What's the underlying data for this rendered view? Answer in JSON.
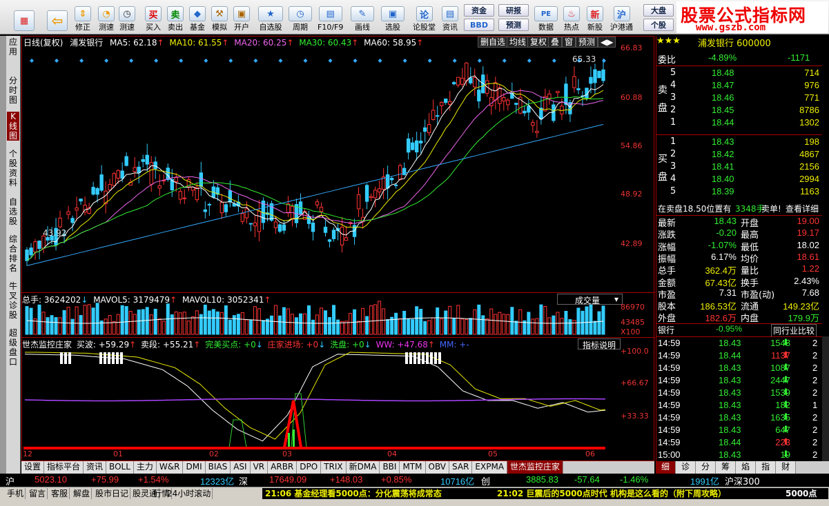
{
  "toolbar": [
    {
      "label": "修正",
      "icon": "↑"
    },
    {
      "label": "测速",
      "icon": "◔"
    },
    {
      "label": "买入",
      "icon": "买"
    },
    {
      "label": "卖出",
      "icon": "卖"
    },
    {
      "label": "基金",
      "icon": "◆"
    },
    {
      "label": "模拟",
      "icon": "⚒"
    },
    {
      "label": "开户",
      "icon": "🔒"
    },
    {
      "label": "自选股",
      "icon": "★"
    },
    {
      "label": "周期",
      "icon": "◷"
    },
    {
      "label": "F10/F9",
      "icon": "▤"
    },
    {
      "label": "画线",
      "icon": "✎"
    },
    {
      "label": "选股",
      "icon": "▣"
    },
    {
      "label": "论股堂",
      "icon": "论"
    },
    {
      "label": "资讯",
      "icon": "▤"
    },
    {
      "label": "数据",
      "icon": "PE"
    },
    {
      "label": "热点",
      "icon": "♨"
    },
    {
      "label": "新股",
      "icon": "新"
    },
    {
      "label": "沪港通",
      "icon": "沪"
    }
  ],
  "toolbar_small": {
    "zijin": "资金",
    "bbd": "BBD",
    "yanbao": "研报",
    "yuce": "预测",
    "dapan": "大盘",
    "gegu": "个股"
  },
  "brand": {
    "title": "股票公式指标网",
    "url": "www.gszb.com"
  },
  "left_tabs": [
    "应用",
    "分时图",
    "K线图",
    "个股资料",
    "自选股",
    "综合排名",
    "牛叉诊股",
    "超级盘口"
  ],
  "chart_header": {
    "period": "日线(复权)",
    "name": "浦发银行",
    "ma5": "MA5: 62.18",
    "ma10": "MA10: 61.55",
    "ma20": "MA20: 60.25",
    "ma30": "MA30: 60.43",
    "ma60": "MA60: 58.95"
  },
  "chart_ctrls": [
    "删自选",
    "均线",
    "复权",
    "叠",
    "窗",
    "预测",
    "◀▶"
  ],
  "price_labels": [
    "66.83",
    "60.88",
    "54.86",
    "48.92",
    "42.89"
  ],
  "high_label": "65.33",
  "low_label": "43.92",
  "vol_header": {
    "total": "总手: 3624202",
    "mavol5": "MAVOL5: 3179479",
    "mavol10": "MAVOL10: 3052341",
    "btn": "成交量"
  },
  "vol_labels": [
    "86970",
    "43485",
    "X100"
  ],
  "ind_header": {
    "name": "世杰监控庄家",
    "buy": "买波: +59.29",
    "sell": "卖段: +55.21",
    "perfect": "完美买点: +0",
    "dealer": "庄家进场: +0",
    "wash": "洗盘: +0",
    "ww": "WW: +47.68",
    "mm": "MM: +-",
    "btn": "指标说明"
  },
  "ind_labels": [
    "+100.0",
    "+66.67",
    "+33.33"
  ],
  "x_labels": [
    "12",
    "01",
    "02",
    "03",
    "04",
    "05",
    "06"
  ],
  "tabs": [
    "设置",
    "指标平台",
    "资讯",
    "BOLL",
    "主力",
    "W&R",
    "DMI",
    "BIAS",
    "ASI",
    "VR",
    "ARBR",
    "DPO",
    "TRIX",
    "新DMA",
    "BBI",
    "MTM",
    "OBV",
    "SAR",
    "EXPMA",
    "世杰监控庄家"
  ],
  "stock": {
    "title": "浦发银行 600000",
    "weibi_label": "委比",
    "weibi_pct": "-4.89%",
    "weibi_val": "-1171"
  },
  "sell_label": "卖盘",
  "buy_label": "买盘",
  "asks": [
    [
      "5",
      "18.48",
      "714"
    ],
    [
      "4",
      "18.47",
      "976"
    ],
    [
      "3",
      "18.46",
      "771"
    ],
    [
      "2",
      "18.45",
      "8786"
    ],
    [
      "1",
      "18.44",
      "1302"
    ]
  ],
  "bids": [
    [
      "1",
      "18.43",
      "198"
    ],
    [
      "2",
      "18.42",
      "4867"
    ],
    [
      "3",
      "18.41",
      "2156"
    ],
    [
      "4",
      "18.40",
      "2994"
    ],
    [
      "5",
      "18.39",
      "1163"
    ]
  ],
  "info_line": {
    "text": "在卖盘18.50位置有",
    "vol": "3348手",
    "link1": "卖单!",
    "link2": "查看详细"
  },
  "quote": [
    [
      "最新",
      "18.43",
      "开盘",
      "19.00"
    ],
    [
      "涨跌",
      "-0.20",
      "最高",
      "19.17"
    ],
    [
      "涨幅",
      "-1.07%",
      "最低",
      "18.02"
    ],
    [
      "振幅",
      "6.17%",
      "均价",
      "18.61"
    ],
    [
      "总手",
      "362.4万",
      "量比",
      "1.22"
    ],
    [
      "金额",
      "67.43亿",
      "换手",
      "2.43%"
    ],
    [
      "市盈",
      "7.31",
      "市盈(动)",
      "7.68"
    ],
    [
      "股本",
      "186.53亿",
      "流通",
      "149.23亿"
    ],
    [
      "外盘",
      "182.6万",
      "内盘",
      "179.9万"
    ]
  ],
  "sector": {
    "name": "银行",
    "pct": "-0.95%",
    "btn": "同行业比较"
  },
  "ticks": [
    [
      "14:59",
      "18.43",
      "1548",
      "2"
    ],
    [
      "14:59",
      "18.44",
      "1137",
      "2"
    ],
    [
      "14:59",
      "18.43",
      "1087",
      "2"
    ],
    [
      "14:59",
      "18.43",
      "2447",
      "2"
    ],
    [
      "14:59",
      "18.43",
      "1539",
      "2"
    ],
    [
      "14:59",
      "18.43",
      "182",
      "1"
    ],
    [
      "14:59",
      "18.43",
      "1635",
      "2"
    ],
    [
      "14:59",
      "18.43",
      "647",
      "2"
    ],
    [
      "14:59",
      "18.44",
      "223",
      "2"
    ],
    [
      "15:00",
      "18.43",
      "19",
      "2"
    ]
  ],
  "right_tabs": [
    "细",
    "诊",
    "分",
    "筹",
    "焰",
    "指",
    "财"
  ],
  "status": {
    "sh": "沪",
    "sh_idx": "5023.10",
    "sh_chg": "+75.99",
    "sh_pct": "+1.54%",
    "sh_amt": "12323亿",
    "sz": "深",
    "sz_idx": "17649.09",
    "sz_chg": "+148.03",
    "sz_pct": "+0.85%",
    "sz_amt": "10716亿",
    "cy": "创",
    "cy_idx": "3885.83",
    "cy_chg": "-57.64",
    "cy_pct": "-1.46%",
    "hs_amt": "1991亿",
    "hs": "沪深300"
  },
  "bottom": {
    "items": [
      "手机",
      "留言",
      "客服",
      "解盘",
      "股市日记",
      "股灵通",
      "行情",
      "24小时滚动"
    ],
    "news1": "21:06 基金经理看5000点：分化震荡将成常态",
    "news2": "21:02 巨震后的5000点时代 机构是这么看的（附下周攻略）",
    "news3": "5000点"
  }
}
